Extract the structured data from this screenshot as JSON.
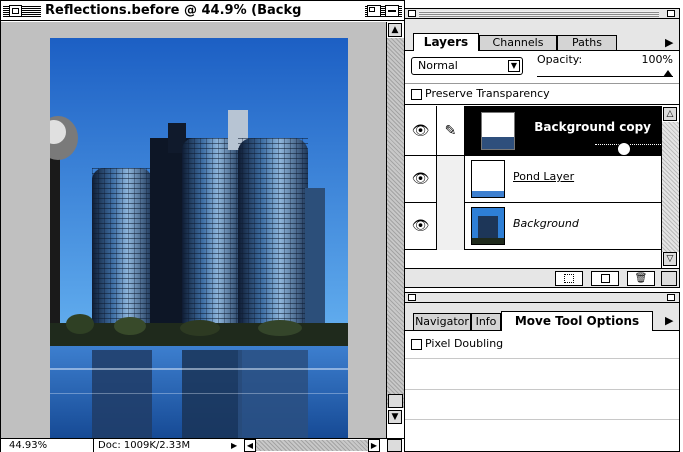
{
  "doc": {
    "title": "Reflections.before @ 44.9% (Backg",
    "zoom": "44.93%",
    "doc_size": "Doc: 1009K/2.33M"
  },
  "layers_panel": {
    "tabs": [
      "Layers",
      "Channels",
      "Paths"
    ],
    "blend_mode": "Normal",
    "opacity_label": "Opacity:",
    "opacity_value": "100%",
    "opacity_fraction": 1.0,
    "preserve_transparency": "Preserve Transparency",
    "preserve_checked": false,
    "layers": [
      {
        "name": "Background copy",
        "selected": true,
        "visible": true,
        "brush": true
      },
      {
        "name": "Pond Layer",
        "selected": false,
        "visible": true,
        "brush": false
      },
      {
        "name": "Background",
        "selected": false,
        "visible": true,
        "brush": false
      }
    ]
  },
  "options_panel": {
    "tabs": [
      "Navigator",
      "Info",
      "Move Tool Options"
    ],
    "pixel_doubling": "Pixel Doubling",
    "pixel_doubling_checked": false
  },
  "colors": {
    "sky": "#2e7fd6",
    "canvas_gray": "#c0c0c0",
    "selected_row": "#000000"
  }
}
